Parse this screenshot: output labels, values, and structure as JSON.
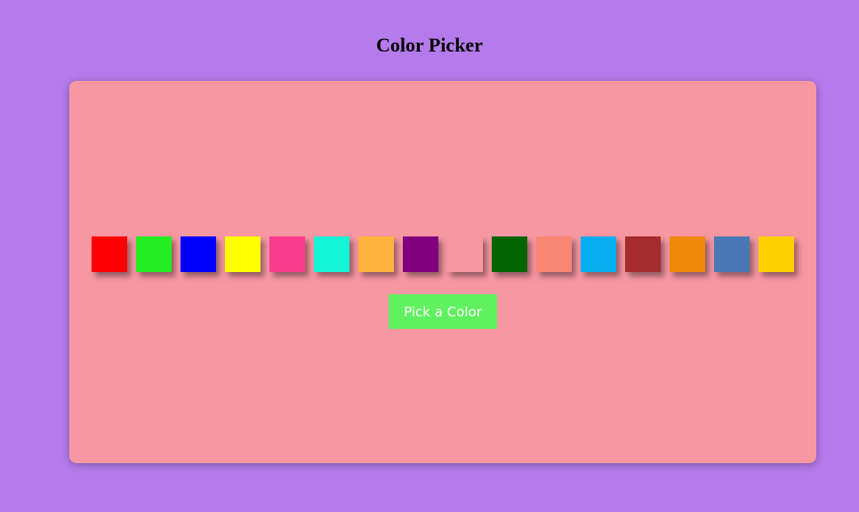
{
  "page": {
    "title": "Color Picker",
    "background": "#b57bec"
  },
  "card": {
    "background": "#f797a2"
  },
  "swatches": [
    {
      "color": "#ff0000"
    },
    {
      "color": "#22ee22"
    },
    {
      "color": "#0000ff"
    },
    {
      "color": "#ffff00"
    },
    {
      "color": "#fd3b8e"
    },
    {
      "color": "#14f4d7"
    },
    {
      "color": "#fdb33b"
    },
    {
      "color": "#800080"
    },
    {
      "color": "#f797a2"
    },
    {
      "color": "#006400"
    },
    {
      "color": "#f98670"
    },
    {
      "color": "#05aeef"
    },
    {
      "color": "#a42c2c"
    },
    {
      "color": "#ee880a"
    },
    {
      "color": "#4a78b6"
    },
    {
      "color": "#ffd000"
    }
  ],
  "button": {
    "label": "Pick a Color",
    "background": "#5ff15f"
  }
}
